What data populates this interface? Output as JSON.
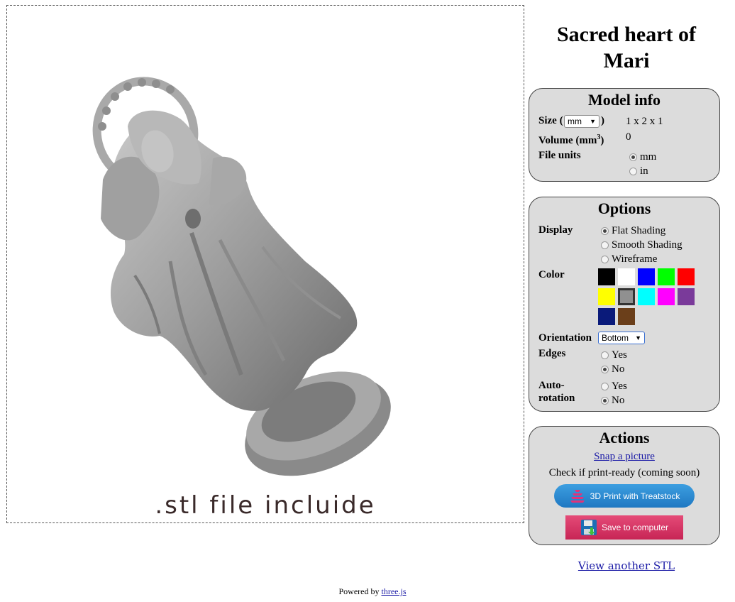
{
  "viewer": {
    "caption": ".stl file incluide"
  },
  "title": "Sacred heart of Mari",
  "model_info": {
    "heading": "Model info",
    "size_label": "Size (",
    "size_label_close": ")",
    "size_unit_selected": "mm",
    "size_value": "1 x 2 x 1",
    "volume_label": "Volume (mm",
    "volume_sup": "3",
    "volume_label_close": ")",
    "volume_value": "0",
    "file_units_label": "File units",
    "file_units_options": [
      "mm",
      "in"
    ],
    "file_units_selected": "mm"
  },
  "options": {
    "heading": "Options",
    "display_label": "Display",
    "display_options": [
      "Flat Shading",
      "Smooth Shading",
      "Wireframe"
    ],
    "display_selected": "Flat Shading",
    "color_label": "Color",
    "colors": [
      "#000000",
      "#ffffff",
      "#0000ff",
      "#00ff00",
      "#ff0000",
      "#ffff00",
      "#909090",
      "#00ffff",
      "#ff00ff",
      "#7a3a9a",
      "#0a1a7a",
      "#6b3f1a"
    ],
    "color_selected": "#909090",
    "orientation_label": "Orientation",
    "orientation_selected": "Bottom",
    "edges_label": "Edges",
    "edges_options": [
      "Yes",
      "No"
    ],
    "edges_selected": "No",
    "autorotation_label_1": "Auto-",
    "autorotation_label_2": "rotation",
    "autorotation_options": [
      "Yes",
      "No"
    ],
    "autorotation_selected": "No"
  },
  "actions": {
    "heading": "Actions",
    "snap_link": "Snap a picture",
    "print_check": "Check if print-ready (coming soon)",
    "treatstock_button": "3D Print with Treatstock",
    "save_button": "Save to computer"
  },
  "view_another": "View another STL",
  "footer": {
    "prefix": "Powered by ",
    "link": "three.js"
  }
}
